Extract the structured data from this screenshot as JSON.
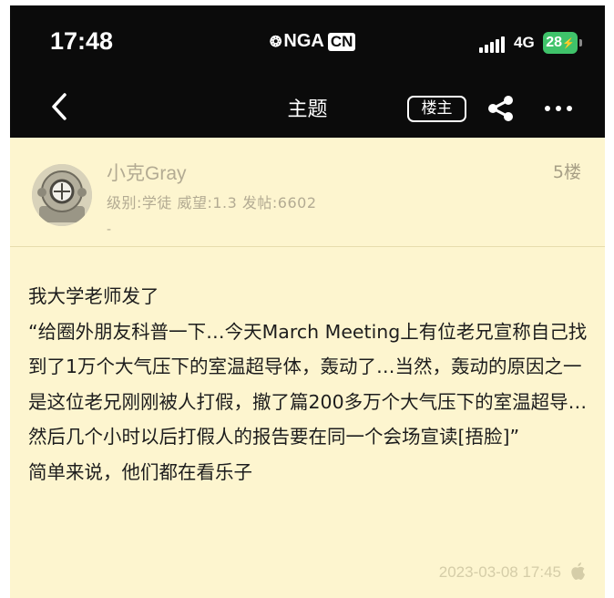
{
  "status_bar": {
    "time": "17:48",
    "logo_text": "NGA",
    "logo_suffix": "CN",
    "network": "4G",
    "battery": "28"
  },
  "nav": {
    "title": "主题",
    "owner_button": "楼主"
  },
  "post": {
    "author": {
      "name": "小克Gray",
      "meta": "级别:学徒  威望:1.3  发帖:6602",
      "extra": "-"
    },
    "floor": "5楼",
    "content_lines": [
      "我大学老师发了",
      "“给圈外朋友科普一下…今天March Meeting上有位老兄宣称自己找到了1万个大气压下的室温超导体，轰动了…当然，轰动的原因之一是这位老兄刚刚被人打假，撤了篇200多万个大气压下的室温超导…然后几个小时以后打假人的报告要在同一个会场宣读[捂脸]”",
      "简单来说，他们都在看乐子"
    ],
    "timestamp": "2023-03-08 17:45"
  },
  "colors": {
    "background": "#fdf5cf",
    "topbar": "#0b0b0b",
    "battery": "#3fc36a",
    "muted_text": "#b3ab93"
  },
  "icons": {
    "back": "chevron-left-icon",
    "share": "share-icon",
    "more": "more-dots-icon",
    "device": "apple-icon"
  }
}
